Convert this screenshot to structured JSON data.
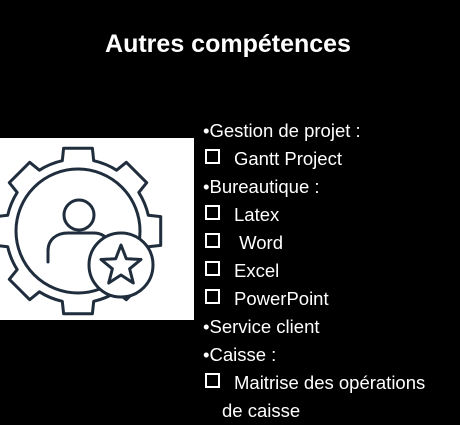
{
  "slide": {
    "title": "Autres compétences",
    "icon": "gear-person-star-icon",
    "colors": {
      "background": "#000000",
      "text": "#ffffff",
      "icon_bg": "#ffffff",
      "icon_stroke": "#1f2d3d"
    },
    "items": [
      {
        "type": "bullet",
        "text": "•Gestion de projet :"
      },
      {
        "type": "checkbox",
        "text": "Gantt Project"
      },
      {
        "type": "bullet",
        "text": "•Bureautique :"
      },
      {
        "type": "checkbox",
        "text": "Latex"
      },
      {
        "type": "checkbox",
        "text": " Word"
      },
      {
        "type": "checkbox",
        "text": "Excel"
      },
      {
        "type": "checkbox",
        "text": "PowerPoint"
      },
      {
        "type": "bullet",
        "text": "•Service client"
      },
      {
        "type": "bullet",
        "text": "•Caisse :"
      },
      {
        "type": "checkbox",
        "text": "Maitrise des opérations"
      },
      {
        "type": "continuation",
        "text": "de caisse"
      }
    ]
  }
}
